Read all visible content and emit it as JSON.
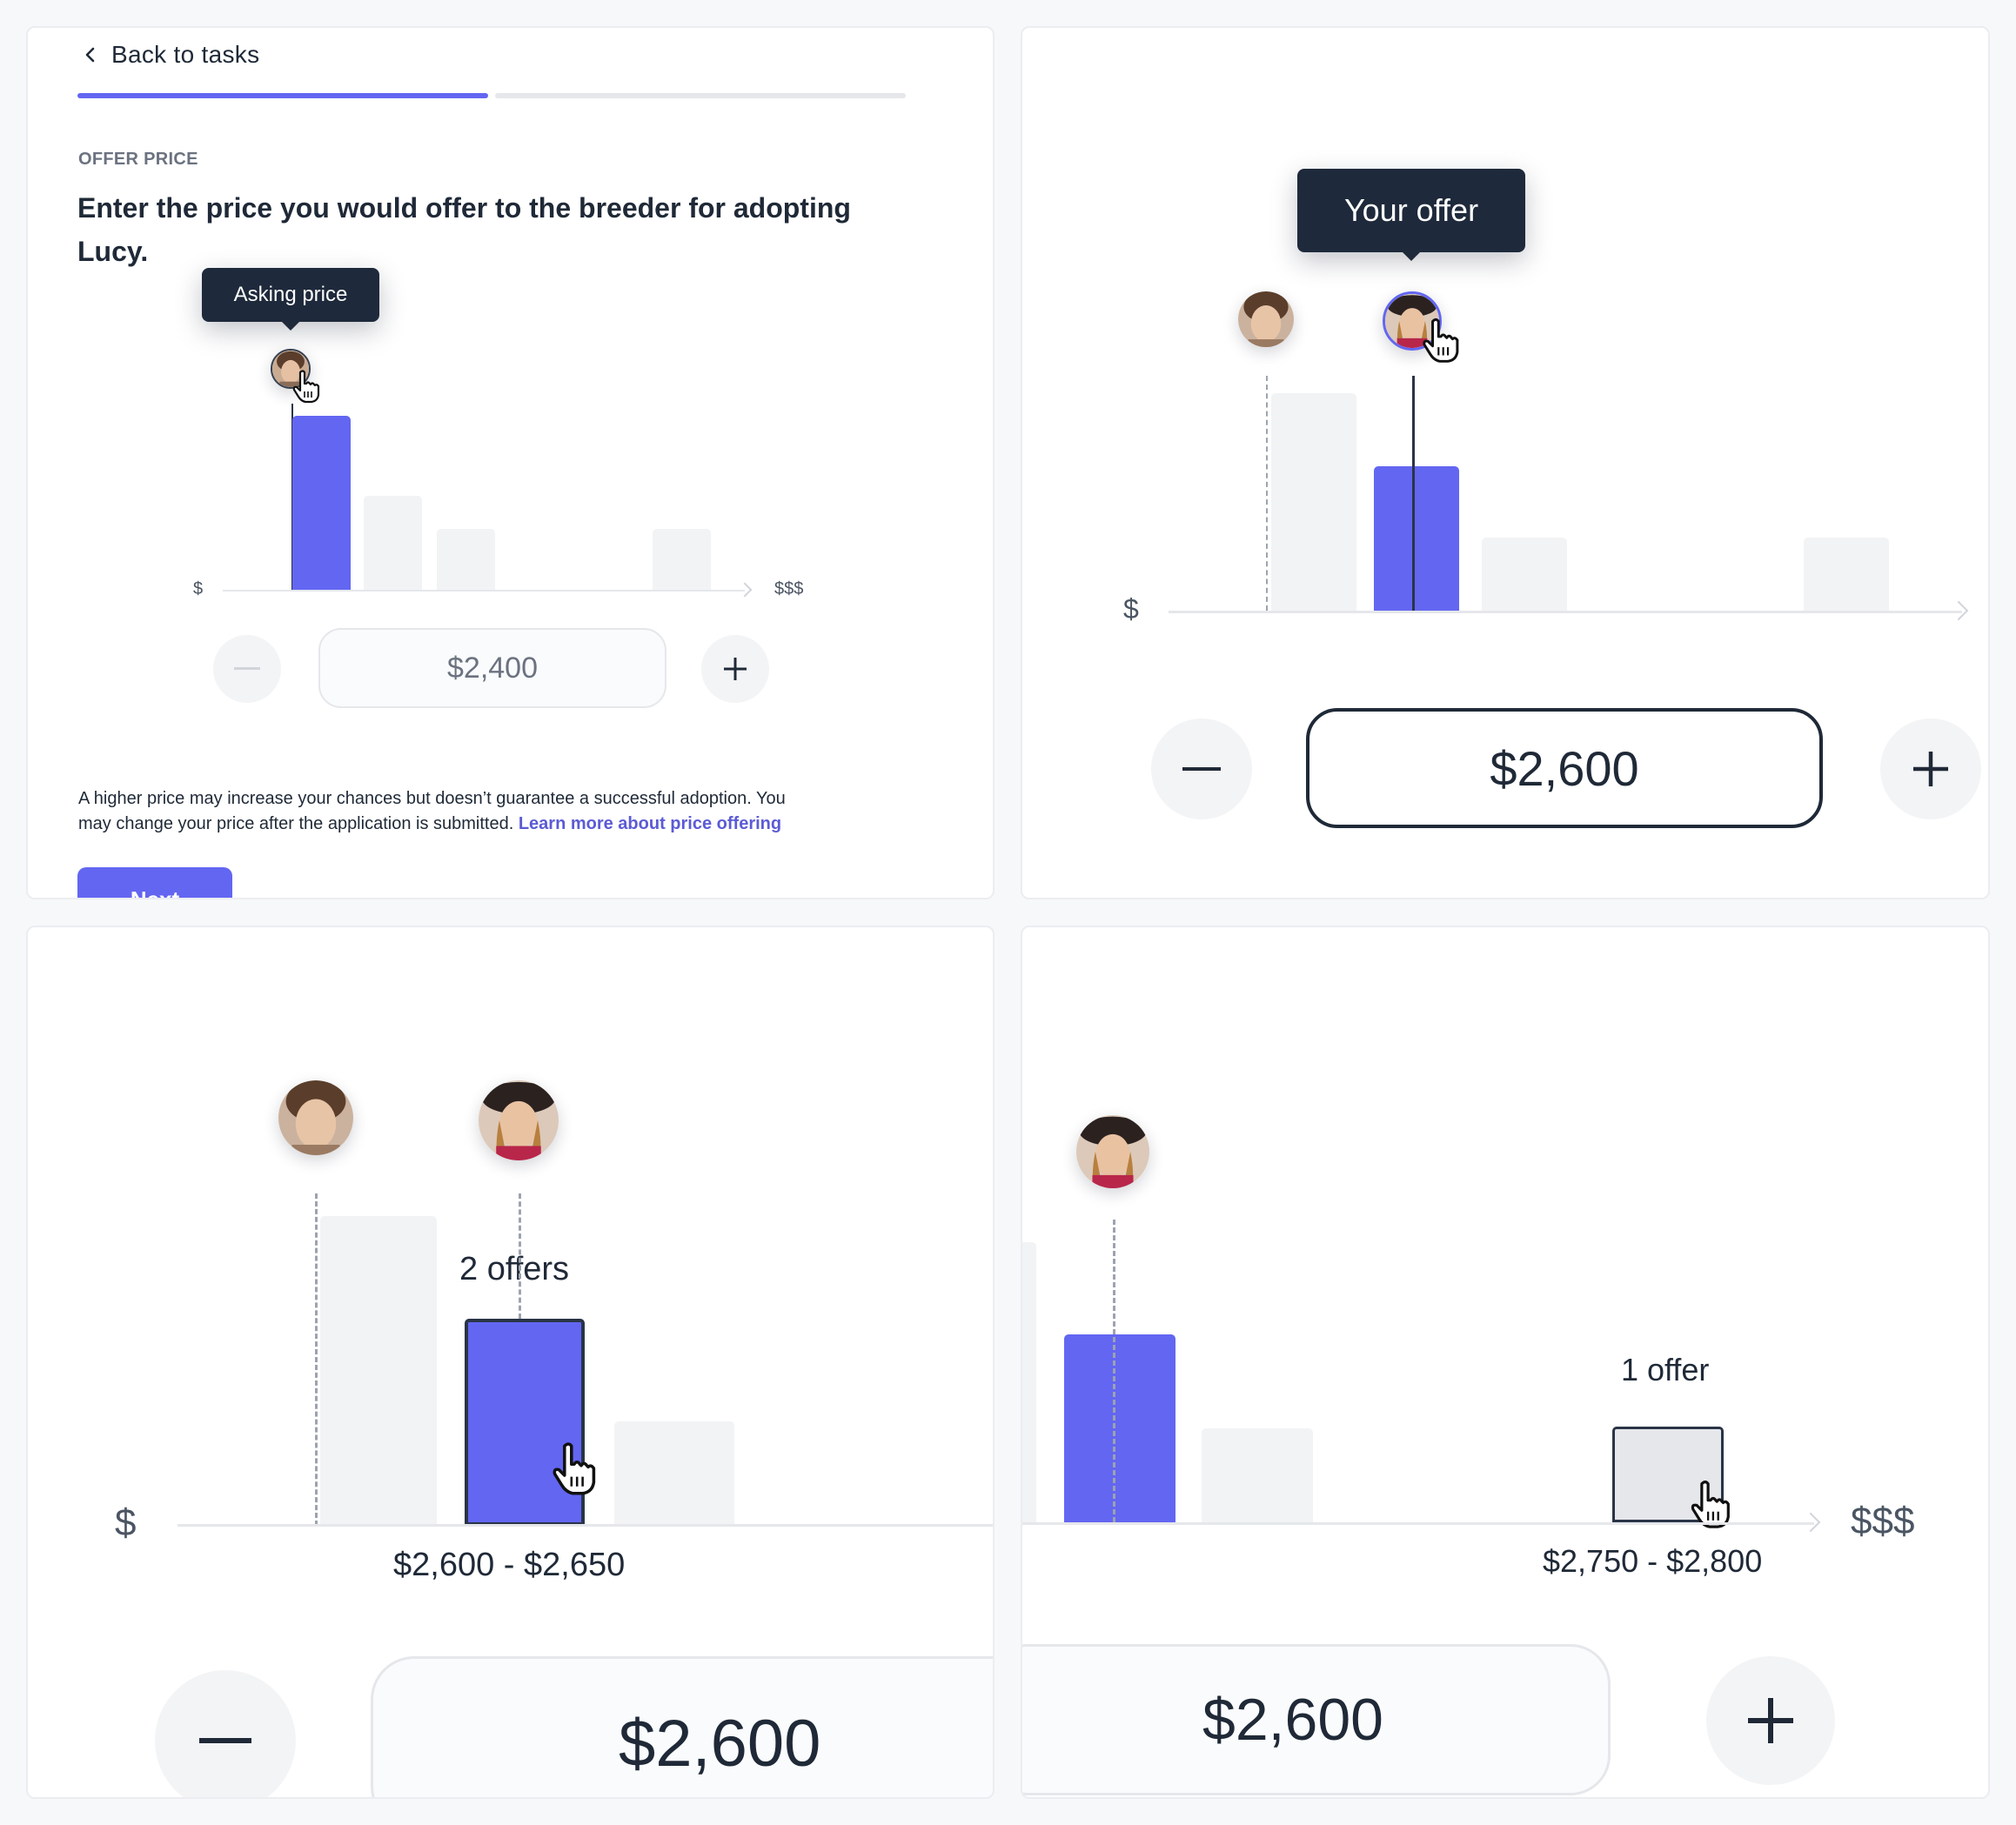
{
  "panel1": {
    "back_label": "Back to tasks",
    "eyebrow": "OFFER PRICE",
    "heading_line1": "Enter the price you would offer to the breeder for adopting",
    "heading_line2": "Lucy.",
    "tooltip": "Asking price",
    "axis_low": "$",
    "axis_high": "$$$",
    "price": "$2,400",
    "note_line1": "A higher price may increase your chances but doesn’t guarantee a successful adoption. You",
    "note_line2": "may change your price after the application is submitted.",
    "note_link": "Learn more about price offering",
    "next_label": "Next",
    "progress_fraction": 0.5
  },
  "panel2": {
    "tooltip": "Your offer",
    "axis_low": "$",
    "price": "$2,600"
  },
  "panel3": {
    "bar_label": "2 offers",
    "axis_low": "$",
    "range_label": "$2,600 - $2,650",
    "price": "$2,600"
  },
  "panel4": {
    "bar_label": "1 offer",
    "axis_high": "$$$",
    "range_label": "$2,750 - $2,800",
    "price": "$2,600"
  },
  "colors": {
    "accent": "#6366f1",
    "dark": "#1e293b",
    "bar_grey": "#f2f3f5",
    "link": "#5b5bd6"
  },
  "icons": [
    "chevron-left-icon",
    "minus-icon",
    "plus-icon",
    "hand-pointer-icon",
    "avatar-man",
    "avatar-woman"
  ]
}
